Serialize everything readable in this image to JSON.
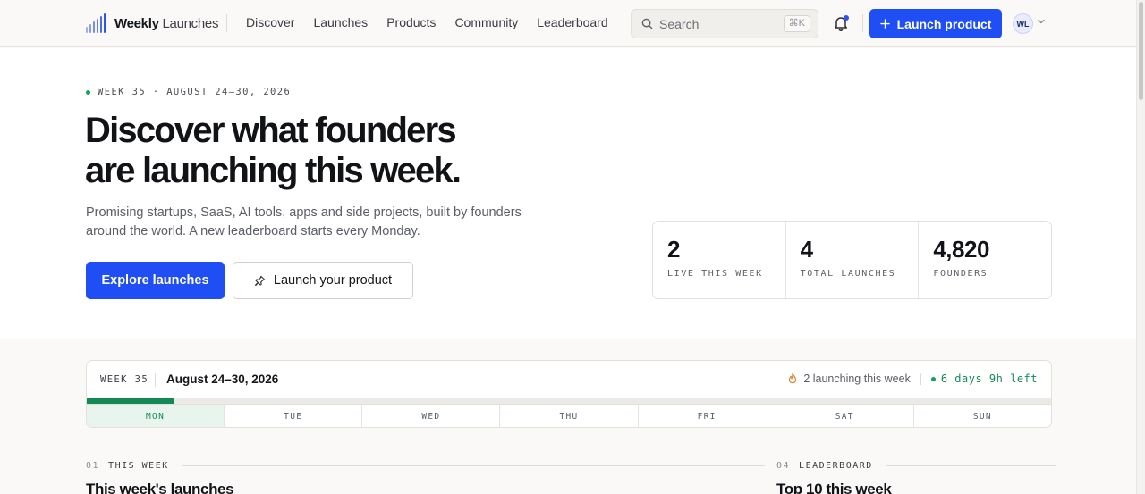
{
  "nav": {
    "logo_bold": "Weekly",
    "logo_light": " Launches",
    "links": [
      "Discover",
      "Launches",
      "Products",
      "Community",
      "Leaderboard"
    ],
    "search_placeholder": "Search",
    "search_shortcut": "⌘K",
    "launch_button": "Launch product",
    "avatar_initials": "WL",
    "accent_color": "#1f4ef5"
  },
  "hero": {
    "eyebrow": "WEEK 35 · AUGUST 24–30, 2026",
    "headline_line1": "Discover what founders",
    "headline_line2": "are launching this week.",
    "subtitle": "Promising startups, SaaS, AI tools, apps and side projects, built by founders around the world. A new leaderboard starts every Monday.",
    "primary_cta": "Explore launches",
    "secondary_cta": "Launch your product",
    "stats": [
      {
        "value": "2",
        "label": "LIVE THIS WEEK"
      },
      {
        "value": "4",
        "label": "TOTAL LAUNCHES"
      },
      {
        "value": "4,820",
        "label": "FOUNDERS"
      }
    ]
  },
  "week": {
    "label": "WEEK 35",
    "range": "August 24–30, 2026",
    "launching": "2 launching this week",
    "time_left": "6 days 9h left",
    "progress": 0.09,
    "days": [
      "MON",
      "TUE",
      "WED",
      "THU",
      "FRI",
      "SAT",
      "SUN"
    ],
    "active_day": 0,
    "status_color": "#138a55"
  },
  "sections": {
    "this_week": {
      "index": "01",
      "label": "THIS WEEK",
      "title": "This week's launches"
    },
    "leaderboard": {
      "index": "04",
      "label": "LEADERBOARD",
      "title": "Top 10 this week"
    }
  }
}
